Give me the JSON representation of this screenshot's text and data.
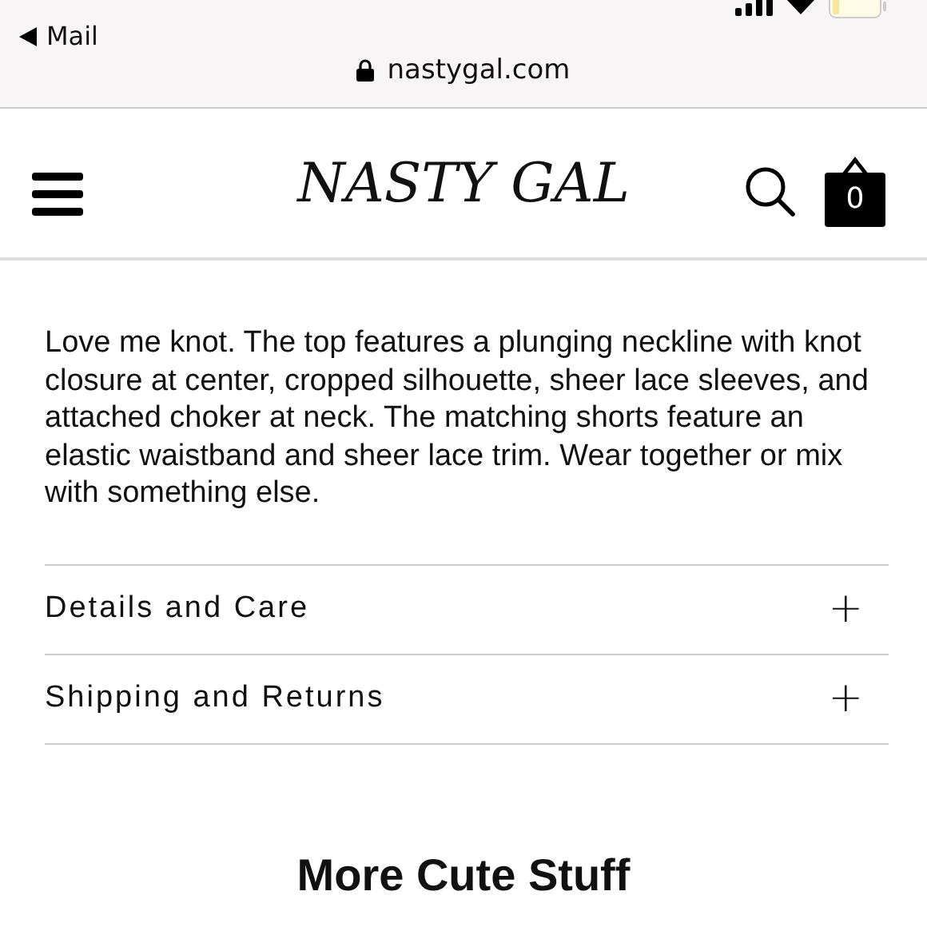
{
  "status_bar": {
    "back_label": "Mail"
  },
  "address_bar": {
    "url": "nastygal.com"
  },
  "header": {
    "logo": "NASTY GAL",
    "cart_count": "0"
  },
  "description": "Love me knot. The top features a plunging neckline with knot closure at center, cropped silhouette, sheer lace sleeves, and attached choker at neck. The matching shorts feature an elastic waistband and sheer lace trim. Wear together or mix with something else.",
  "accordion": [
    {
      "label": "Details and Care",
      "toggle": "+"
    },
    {
      "label": "Shipping and Returns",
      "toggle": "+"
    }
  ],
  "section_title": "More Cute Stuff"
}
